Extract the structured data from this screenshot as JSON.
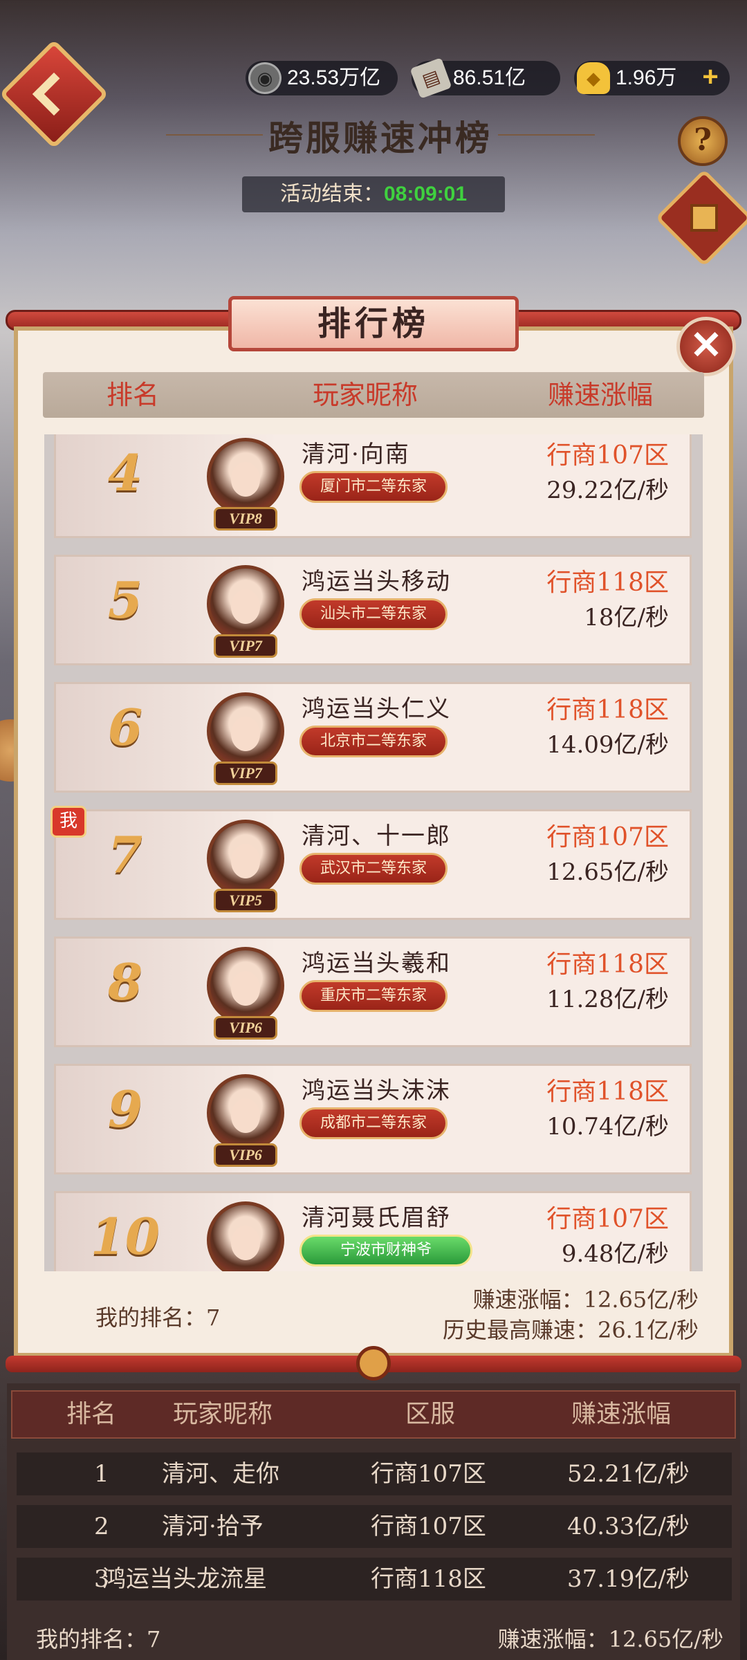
{
  "topbar": {
    "resources": [
      {
        "icon": "copper-coin-icon",
        "value": "23.53万亿"
      },
      {
        "icon": "ledger-book-icon",
        "value": "86.51亿"
      },
      {
        "icon": "gold-ingot-icon",
        "value": "1.96万"
      }
    ]
  },
  "event": {
    "title": "跨服赚速冲榜",
    "countdown_label": "活动结束：",
    "countdown_time": "08:09:01"
  },
  "panel": {
    "title": "排行榜",
    "columns": [
      "排名",
      "玩家昵称",
      "赚速涨幅"
    ],
    "rows": [
      {
        "rank": "4",
        "name": "清河·向南",
        "title": "厦门市二等东家",
        "vip": "VIP8",
        "server": "行商107区",
        "speed": "29.22亿/秒",
        "me": false,
        "green": false
      },
      {
        "rank": "5",
        "name": "鸿运当头移动",
        "title": "汕头市二等东家",
        "vip": "VIP7",
        "server": "行商118区",
        "speed": "18亿/秒",
        "me": false,
        "green": false
      },
      {
        "rank": "6",
        "name": "鸿运当头仁义",
        "title": "北京市二等东家",
        "vip": "VIP7",
        "server": "行商118区",
        "speed": "14.09亿/秒",
        "me": false,
        "green": false
      },
      {
        "rank": "7",
        "name": "清河、十一郎",
        "title": "武汉市二等东家",
        "vip": "VIP5",
        "server": "行商107区",
        "speed": "12.65亿/秒",
        "me": true,
        "green": false
      },
      {
        "rank": "8",
        "name": "鸿运当头羲和",
        "title": "重庆市二等东家",
        "vip": "VIP6",
        "server": "行商118区",
        "speed": "11.28亿/秒",
        "me": false,
        "green": false
      },
      {
        "rank": "9",
        "name": "鸿运当头沫沫",
        "title": "成都市二等东家",
        "vip": "VIP6",
        "server": "行商118区",
        "speed": "10.74亿/秒",
        "me": false,
        "green": false
      },
      {
        "rank": "10",
        "name": "清河聂氏眉舒",
        "title": "宁波市财神爷",
        "vip": "",
        "server": "行商107区",
        "speed": "9.48亿/秒",
        "me": false,
        "green": true
      }
    ],
    "me_badge": "我",
    "my_rank_label": "我的排名：7",
    "my_speed_label": "赚速涨幅：12.65亿/秒",
    "best_speed_label": "历史最高赚速：26.1亿/秒"
  },
  "lower": {
    "columns": [
      "排名",
      "玩家昵称",
      "区服",
      "赚速涨幅"
    ],
    "rows": [
      {
        "rank": "1",
        "name": "清河、走你",
        "server": "行商107区",
        "speed": "52.21亿/秒"
      },
      {
        "rank": "2",
        "name": "清河·拾予",
        "server": "行商107区",
        "speed": "40.33亿/秒"
      },
      {
        "rank": "3",
        "name": "鸿运当头龙流星",
        "server": "行商118区",
        "speed": "37.19亿/秒"
      }
    ],
    "my_rank_label": "我的排名：7",
    "my_speed_label": "赚速涨幅：12.65亿/秒"
  }
}
